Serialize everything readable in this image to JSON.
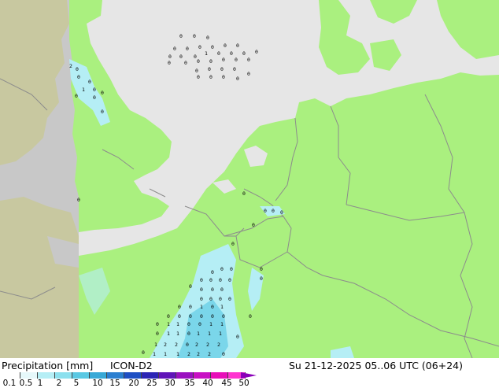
{
  "title": "Precipitation [mm]",
  "model": "ICON-D2",
  "valid_time": "Su 21-12-2025 05..06 UTC (06+24)",
  "legend": {
    "ticks": [
      "0.1",
      "0.5",
      "1",
      "2",
      "5",
      "10",
      "15",
      "20",
      "25",
      "30",
      "35",
      "40",
      "45",
      "50"
    ],
    "colors": [
      "#ffffff",
      "#e6f8fa",
      "#b5eef5",
      "#8ce0ee",
      "#5ac8e3",
      "#38a9d7",
      "#2b7fd0",
      "#1e4fc3",
      "#2c25b5",
      "#6014b8",
      "#9a10c0",
      "#c810c4",
      "#e80fb9",
      "#ff33d0"
    ],
    "arrow_color": "#8a00b8"
  },
  "map_colors": {
    "land": "#aaf07f",
    "sea": "#e6e6e6",
    "outside_domain": "#c8c8c8",
    "outside_domain_land": "#c8c8a0",
    "borders": "#8c8c8c",
    "precip_light": "#b5eef5",
    "precip_medium": "#7ad6ea"
  },
  "precip_values_sample": [
    "0",
    "1",
    "2"
  ]
}
